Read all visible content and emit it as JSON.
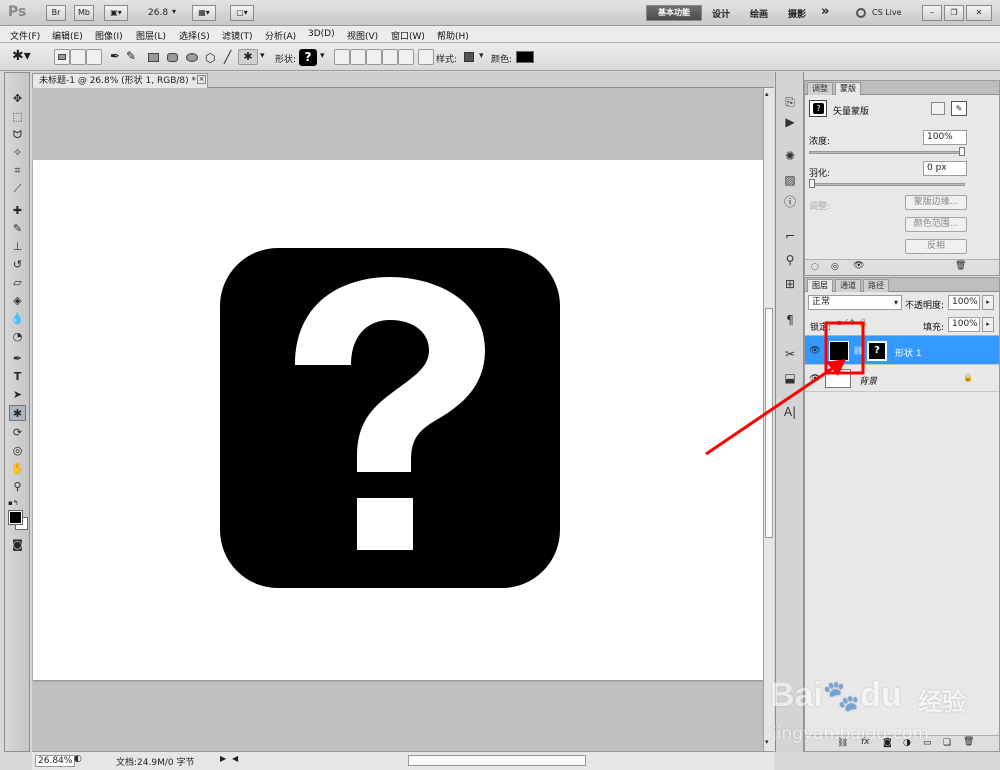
{
  "app": {
    "logo": "Ps",
    "title_buttons": [
      "Br",
      "Mb"
    ],
    "zoom_value": "26.8",
    "workspace": {
      "active": "基本功能",
      "others": [
        "设计",
        "绘画",
        "摄影"
      ],
      "more": "»",
      "cslive": "CS Live"
    }
  },
  "menu": [
    "文件(F)",
    "编辑(E)",
    "图像(I)",
    "图层(L)",
    "选择(S)",
    "滤镜(T)",
    "分析(A)",
    "3D(D)",
    "视图(V)",
    "窗口(W)",
    "帮助(H)"
  ],
  "options": {
    "shape_label": "形状:",
    "style_label": "样式:",
    "color_label": "颜色:",
    "color_hex": "#000000"
  },
  "document": {
    "tab_title": "未标题-1 @ 26.8% (形状 1, RGB/8) *",
    "canvas_shape": "question-mark-rounded-square",
    "shape_color": "#000000"
  },
  "status": {
    "zoom": "26.84%",
    "doc_info": "文档:24.9M/0 字节"
  },
  "masks_panel": {
    "tabs": [
      "调整",
      "蒙版"
    ],
    "title": "矢量蒙版",
    "density_label": "浓度:",
    "density_value": "100%",
    "feather_label": "羽化:",
    "feather_value": "0 px",
    "refine_label": "调整:",
    "buttons": [
      "蒙版边缘...",
      "颜色范围...",
      "反相"
    ]
  },
  "layers_panel": {
    "tabs": [
      "图层",
      "通道",
      "路径"
    ],
    "blend_mode": "正常",
    "opacity_label": "不透明度:",
    "opacity_value": "100%",
    "lock_label": "锁定:",
    "fill_label": "填充:",
    "fill_value": "100%",
    "layers": [
      {
        "name": "形状 1",
        "selected": true
      },
      {
        "name": "背景",
        "selected": false
      }
    ]
  },
  "watermark": {
    "brand": "Bai",
    "brand2": "du",
    "cn": "经验",
    "url": "jingyan.baidu.com"
  },
  "colors": {
    "highlight": "#3399ff",
    "annotation": "#ff0000"
  }
}
